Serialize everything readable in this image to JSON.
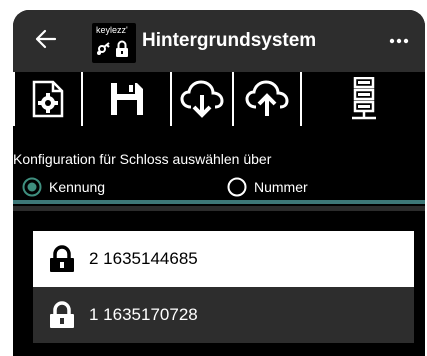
{
  "app": {
    "title": "Hintergrundsystem",
    "logo_text": "keylezz'"
  },
  "toolbar": {
    "items": [
      {
        "icon": "settings-file-icon"
      },
      {
        "icon": "save-icon"
      },
      {
        "icon": "cloud-download-icon"
      },
      {
        "icon": "cloud-upload-icon"
      },
      {
        "icon": "server-icon"
      }
    ]
  },
  "config": {
    "label": "Konfiguration für Schloss auswählen über",
    "options": [
      {
        "label": "Kennung",
        "selected": true
      },
      {
        "label": "Nummer",
        "selected": false
      }
    ]
  },
  "locks": [
    {
      "label": "2 1635144685",
      "selected": true
    },
    {
      "label": "1 1635170728",
      "selected": false
    }
  ],
  "colors": {
    "appbar": "#2d2d2d",
    "background": "#000000",
    "accent_divider": "#3d7777",
    "radio_selected": "#3f8f7f"
  }
}
